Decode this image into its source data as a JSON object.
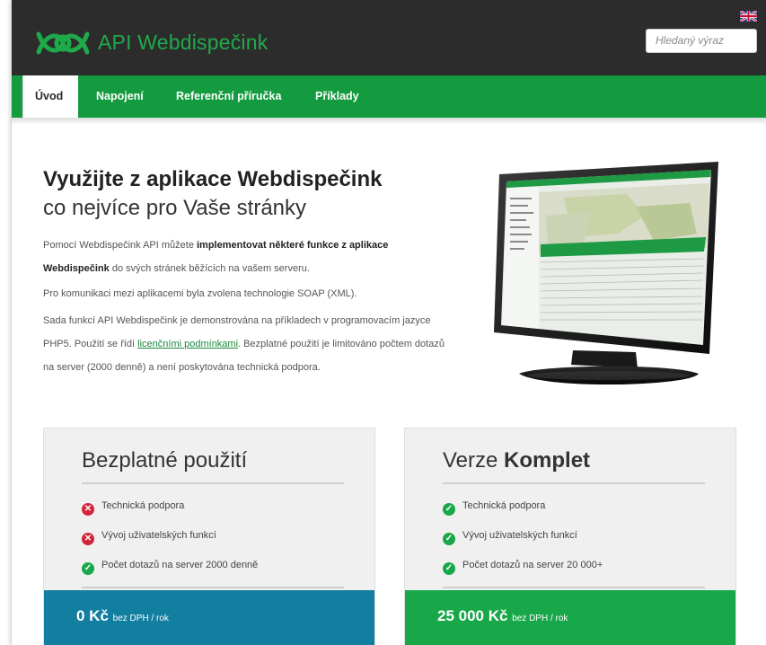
{
  "header": {
    "brand": "API Webdispečink",
    "search_placeholder": "Hledaný výraz",
    "lang_flag_icon": "uk-flag-icon"
  },
  "nav": {
    "items": [
      {
        "label": "Úvod",
        "active": true
      },
      {
        "label": "Napojení",
        "active": false
      },
      {
        "label": "Referenční příručka",
        "active": false
      },
      {
        "label": "Příklady",
        "active": false
      }
    ]
  },
  "hero": {
    "title_bold": "Využijte z aplikace Webdispečink",
    "title_light": "co nejvíce pro Vaše stránky",
    "p1_pre": "Pomocí Webdispečink API můžete ",
    "p1_bold": "implementovat některé funkce z aplikace Webdispečink",
    "p1_post": " do svých stránek běžících na vašem serveru.",
    "p2": "Pro komunikaci mezi aplikacemi byla zvolena technologie SOAP (XML).",
    "p3_pre": "Sada funkcí API Webdispečink je demonstrována na příkladech v programovacím jazyce PHP5. Použití se řídí ",
    "p3_link": "licenčními podmínkami",
    "p3_post": ". Bezplatné použití je limitováno počtem dotazů na server (2000 denně) a není poskytována technická podpora."
  },
  "plans": [
    {
      "title": "Bezplatné použití",
      "title_bold": "",
      "features": [
        {
          "label": "Technická podpora",
          "included": false
        },
        {
          "label": "Vývoj uživatelských funkcí",
          "included": false
        },
        {
          "label": "Počet dotazů na server 2000 denně",
          "included": true
        }
      ],
      "price": "0 Kč",
      "price_unit": "bez DPH / rok",
      "price_color": "#127ea0"
    },
    {
      "title": "Verze ",
      "title_bold": "Komplet",
      "features": [
        {
          "label": "Technická podpora",
          "included": true
        },
        {
          "label": "Vývoj uživatelských funkcí",
          "included": true
        },
        {
          "label": "Počet dotazů na server 20 000+",
          "included": true
        }
      ],
      "price": "25 000 Kč",
      "price_unit": "bez DPH / rok",
      "price_color": "#18a84a"
    }
  ],
  "colors": {
    "header_bg": "#2c2c2c",
    "accent_green": "#149a3f",
    "free_blue": "#127ea0",
    "error_red": "#d2263a"
  }
}
